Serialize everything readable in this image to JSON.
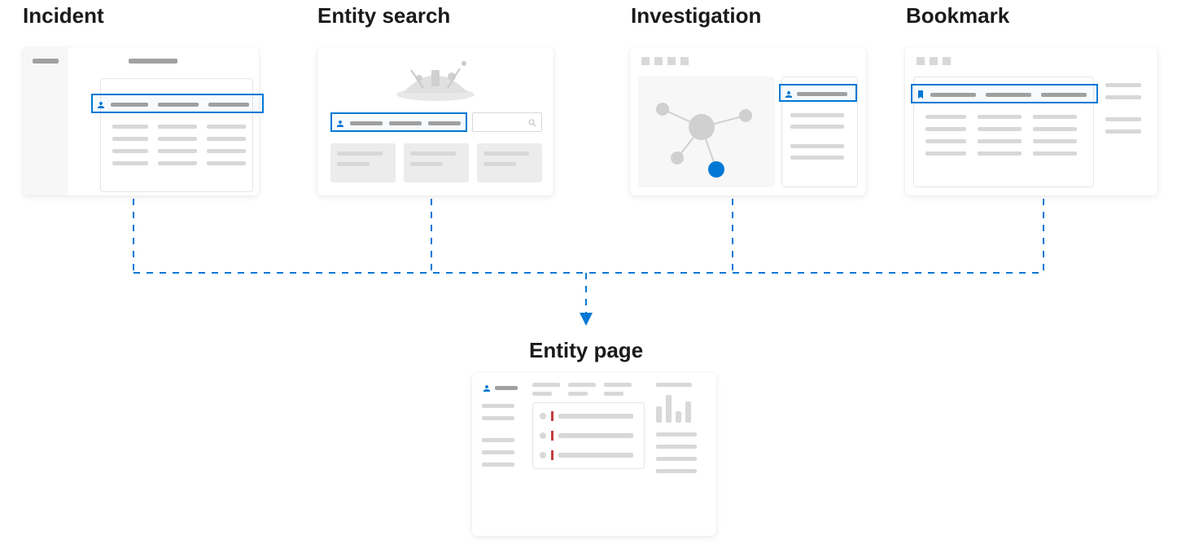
{
  "nodes": {
    "incident": {
      "label": "Incident"
    },
    "entity_search": {
      "label": "Entity search"
    },
    "investigation": {
      "label": "Investigation"
    },
    "bookmark": {
      "label": "Bookmark"
    },
    "entity_page": {
      "label": "Entity page"
    }
  },
  "colors": {
    "accent": "#0078d4",
    "placeholder": "#d8d8d8",
    "placeholder_light": "#ececec",
    "placeholder_dark": "#a0a0a0",
    "alert_marker": "#c43e3e"
  },
  "diagram": {
    "description": "Four source nodes (Incident, Entity search, Investigation, Bookmark) flow via dashed connectors into a single Entity page destination node.",
    "edges": [
      {
        "from": "incident",
        "to": "entity_page"
      },
      {
        "from": "entity_search",
        "to": "entity_page"
      },
      {
        "from": "investigation",
        "to": "entity_page"
      },
      {
        "from": "bookmark",
        "to": "entity_page"
      }
    ]
  }
}
